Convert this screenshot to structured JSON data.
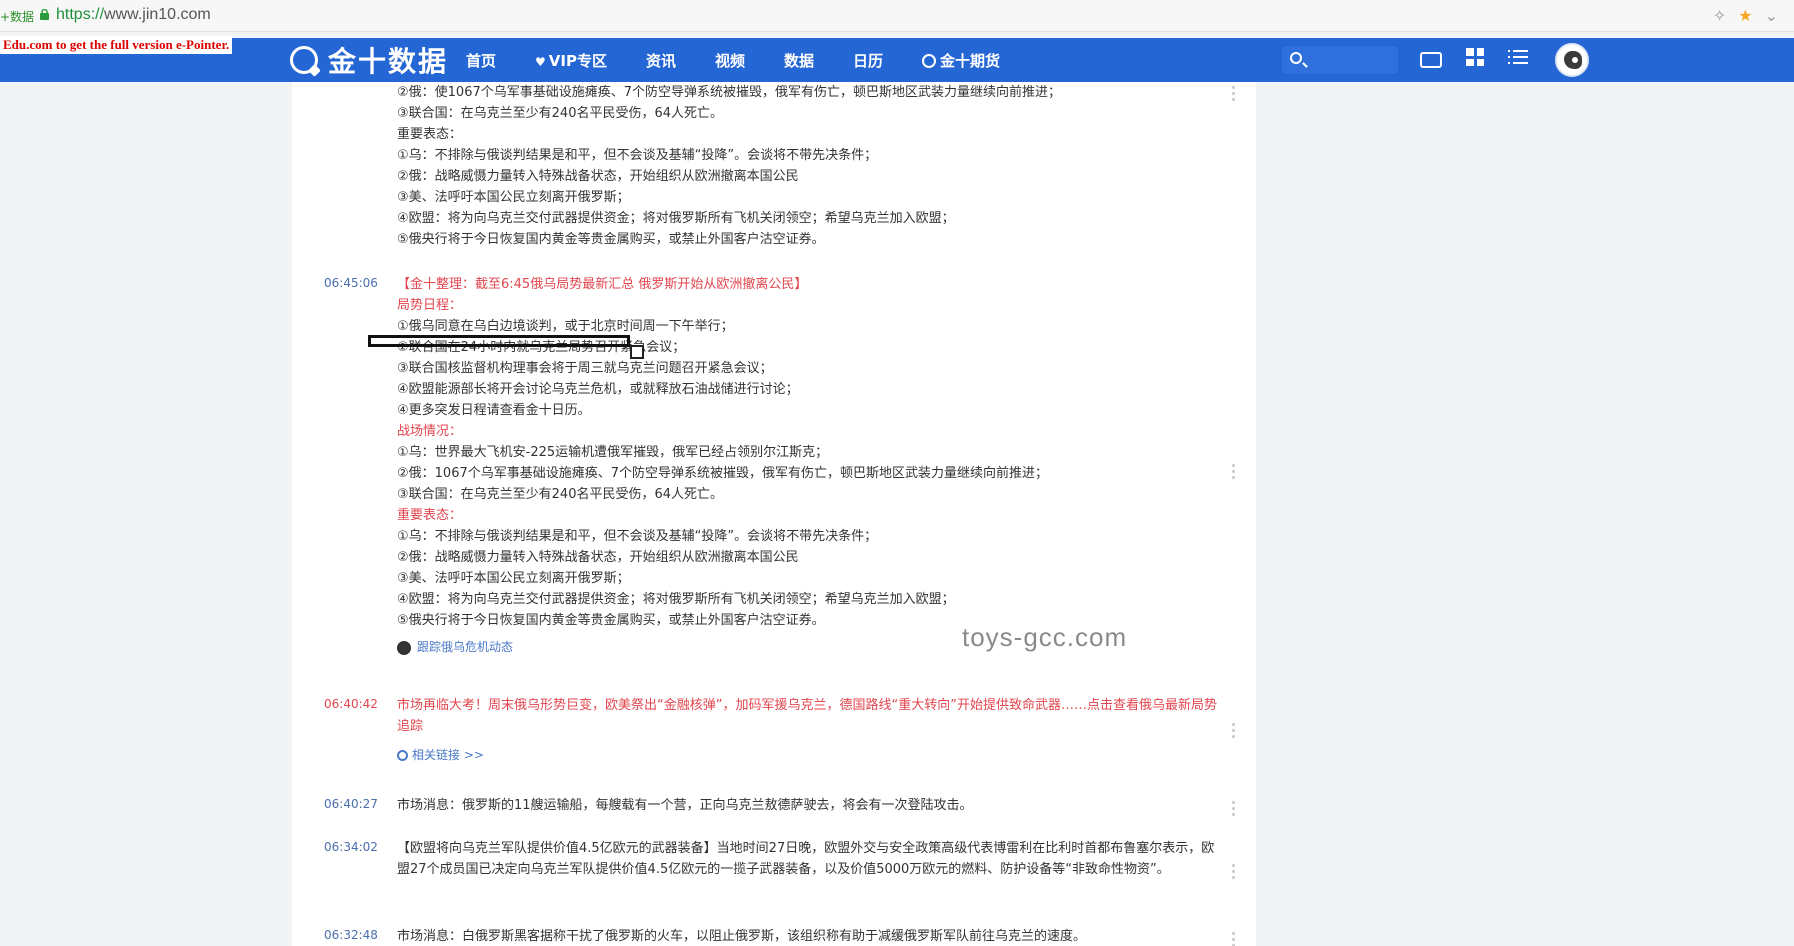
{
  "browser": {
    "tab_fragment": "+数据",
    "url_scheme": "https://",
    "url_host": "www.jin10.com"
  },
  "watermark_text": "Edu.com to get the full version e-Pointer.",
  "site_watermark": "toys-gcc.com",
  "header": {
    "logo_text": "金十数据",
    "nav": [
      {
        "label": "首页"
      },
      {
        "label": "VIP专区"
      },
      {
        "label": "资讯"
      },
      {
        "label": "视频"
      },
      {
        "label": "数据"
      },
      {
        "label": "日历"
      },
      {
        "label": "金十期货"
      }
    ]
  },
  "feed": {
    "top_block": {
      "lines": [
        "②俄：使1067个乌军事基础设施瘫痪、7个防空导弹系统被摧毁，俄军有伤亡，顿巴斯地区武装力量继续向前推进；",
        "③联合国：在乌克兰至少有240名平民受伤，64人死亡。",
        "重要表态：",
        "①乌：不排除与俄谈判结果是和平，但不会谈及基辅“投降”。会谈将不带先决条件；",
        "②俄：战略威慑力量转入特殊战备状态，开始组织从欧洲撤离本国公民",
        "③美、法呼吁本国公民立刻离开俄罗斯；",
        "④欧盟：将为向乌克兰交付武器提供资金；将对俄罗斯所有飞机关闭领空；希望乌克兰加入欧盟；",
        "⑤俄央行将于今日恢复国内黄金等贵金属购买，或禁止外国客户沽空证券。"
      ]
    },
    "entry1": {
      "time": "06:45:06",
      "headline": "【金十整理：截至6:45俄乌局势最新汇总 俄罗斯开始从欧洲撤离公民】",
      "section1": "局势日程：",
      "sched": [
        "①俄乌同意在乌白边境谈判，或于北京时间周一下午举行；",
        "②联合国在24小时内就乌克兰局势召开紧急会议；",
        "③联合国核监督机构理事会将于周三就乌克兰问题召开紧急会议；",
        "④欧盟能源部长将开会讨论乌克兰危机，或就释放石油战储进行讨论；",
        "④更多突发日程请查看金十日历。"
      ],
      "section2": "战场情况：",
      "battle": [
        "①乌：世界最大飞机安-225运输机遭俄军摧毁，俄军已经占领别尔江斯克；",
        "②俄：1067个乌军事基础设施瘫痪、7个防空导弹系统被摧毁，俄军有伤亡，顿巴斯地区武装力量继续向前推进；",
        "③联合国：在乌克兰至少有240名平民受伤，64人死亡。"
      ],
      "section3": "重要表态：",
      "remarks": [
        "①乌：不排除与俄谈判结果是和平，但不会谈及基辅“投降”。会谈将不带先决条件；",
        "②俄：战略威慑力量转入特殊战备状态，开始组织从欧洲撤离本国公民",
        "③美、法呼吁本国公民立刻离开俄罗斯；",
        "④欧盟：将为向乌克兰交付武器提供资金；将对俄罗斯所有飞机关闭领空；希望乌克兰加入欧盟；",
        "⑤俄央行将于今日恢复国内黄金等贵金属购买，或禁止外国客户沽空证券。"
      ],
      "follow_label": "跟踪俄乌危机动态"
    },
    "entry2": {
      "time": "06:40:42",
      "headline": "市场再临大考！周末俄乌形势巨变，欧美祭出“金融核弹”，加码军援乌克兰，德国路线“重大转向”开始提供致命武器……点击查看俄乌最新局势追踪",
      "link_label": "相关链接 >>"
    },
    "entry3": {
      "time": "06:40:27",
      "text": "市场消息：俄罗斯的11艘运输船，每艘载有一个营，正向乌克兰敖德萨驶去，将会有一次登陆攻击。"
    },
    "entry4": {
      "time": "06:34:02",
      "text": "【欧盟将向乌克兰军队提供价值4.5亿欧元的武器装备】当地时间27日晚，欧盟外交与安全政策高级代表博雷利在比利时首都布鲁塞尔表示，欧盟27个成员国已决定向乌克兰军队提供价值4.5亿欧元的一揽子武器装备，以及价值5000万欧元的燃料、防护设备等“非致命性物资”。"
    },
    "entry5": {
      "time": "06:32:48",
      "text": "市场消息：白俄罗斯黑客据称干扰了俄罗斯的火车，以阻止俄罗斯，该组织称有助于减缓俄罗斯军队前往乌克兰的速度。"
    }
  }
}
